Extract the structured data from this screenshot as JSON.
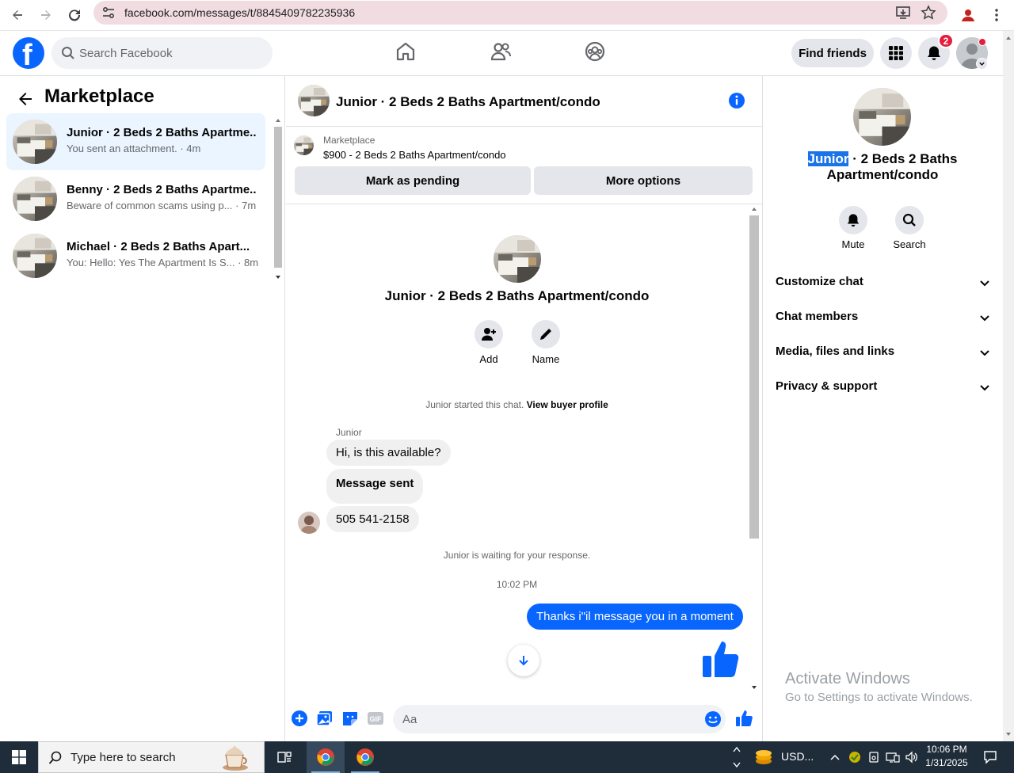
{
  "browser": {
    "url": "facebook.com/messages/t/8845409782235936"
  },
  "header": {
    "search_placeholder": "Search Facebook",
    "find_friends": "Find friends",
    "notification_count": "2"
  },
  "left_panel": {
    "title": "Marketplace",
    "conversations": [
      {
        "name": "Junior · 2 Beds 2 Baths Apartme...",
        "preview": "You sent an attachment. · 4m",
        "active": true
      },
      {
        "name": "Benny · 2 Beds 2 Baths Apartme...",
        "preview": "Beware of common scams using p... · 7m",
        "active": false
      },
      {
        "name": "Michael · 2 Beds 2 Baths Apart...",
        "preview": "You: Hello: Yes The Apartment Is S... · 8m",
        "active": false
      }
    ]
  },
  "chat": {
    "header_title": "Junior · 2 Beds 2 Baths Apartment/condo",
    "listing_label": "Marketplace",
    "listing_price": "$900 - 2 Beds 2 Baths Apartment/condo",
    "mark_pending": "Mark as pending",
    "more_options": "More options",
    "intro_title": "Junior · 2 Beds 2 Baths Apartment/condo",
    "add_label": "Add",
    "name_label": "Name",
    "started_text": "Junior started this chat.",
    "view_buyer_profile": "View buyer profile",
    "sender_name": "Junior",
    "messages_in": [
      "Hi, is this available?",
      "Message sent",
      "505 541-2158"
    ],
    "waiting_text": "Junior is waiting for your response.",
    "timestamp": "10:02 PM",
    "message_out": "Thanks i\"il message you in a moment",
    "composer_placeholder": "Aa"
  },
  "right_panel": {
    "title_highlight": "Junior",
    "title_rest": " · 2 Beds 2 Baths Apartment/condo",
    "mute_label": "Mute",
    "search_label": "Search",
    "sections": [
      "Customize chat",
      "Chat members",
      "Media, files and links",
      "Privacy & support"
    ]
  },
  "watermark": {
    "line1": "Activate Windows",
    "line2": "Go to Settings to activate Windows."
  },
  "taskbar": {
    "search_label": "Type here to search",
    "ticker": "USD...",
    "time": "10:06 PM",
    "date": "1/31/2025"
  },
  "colors": {
    "fb_blue": "#0866ff",
    "active_conv": "#ebf5ff",
    "notif_red": "#e41e3f"
  }
}
